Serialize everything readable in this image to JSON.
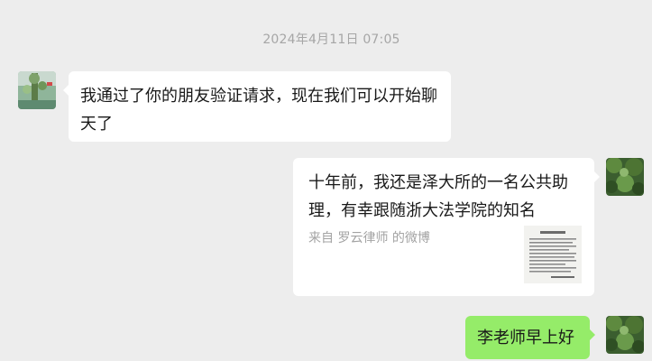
{
  "chat": {
    "timestamp": "2024年4月11日 07:05",
    "messages": [
      {
        "side": "left",
        "avatar_icon": "contact-avatar-icon",
        "text": "我通过了你的朋友验证请求，现在我们可以开始聊天了"
      },
      {
        "side": "right",
        "avatar_icon": "self-avatar-icon",
        "type": "link-card",
        "title": "十年前，我还是泽大所的一名公共助理，有幸跟随浙大法学院的知名",
        "source": "来自 罗云律师 的微博",
        "thumb_icon": "document-thumbnail-icon"
      },
      {
        "side": "right",
        "avatar_icon": "self-avatar-icon",
        "text": "李老师早上好"
      }
    ]
  },
  "colors": {
    "background": "#ededed",
    "bubble_white": "#ffffff",
    "bubble_green": "#95ec69",
    "timestamp_text": "#a6a6a6"
  }
}
